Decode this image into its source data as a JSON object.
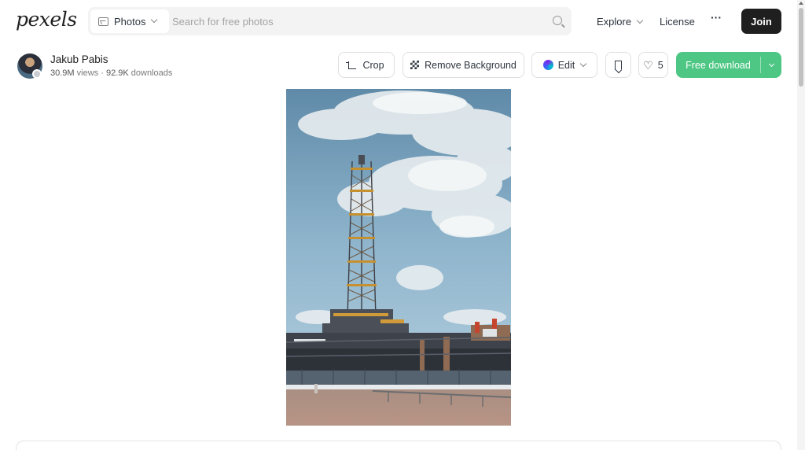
{
  "header": {
    "logo": "pexels",
    "search": {
      "type_label": "Photos",
      "placeholder": "Search for free photos"
    },
    "nav": {
      "explore": "Explore",
      "license": "License",
      "more": "···"
    },
    "join_label": "Join"
  },
  "author": {
    "name": "Jakub Pabis",
    "views": "30.9M",
    "views_label": "views",
    "separator": "·",
    "downloads": "92.9K",
    "downloads_label": "downloads"
  },
  "actions": {
    "crop_label": "Crop",
    "remove_bg_label": "Remove Background",
    "edit_label": "Edit",
    "like_count": "5",
    "download_label": "Free download"
  },
  "colors": {
    "download_green": "#4ec784",
    "join_black": "#1f1f1f",
    "sky_blue": "#8eb4cc"
  },
  "icons": [
    "image-icon",
    "chevron-down-icon",
    "search-icon",
    "crop-icon",
    "checkerboard-icon",
    "canva-icon",
    "bookmark-icon",
    "heart-icon"
  ]
}
